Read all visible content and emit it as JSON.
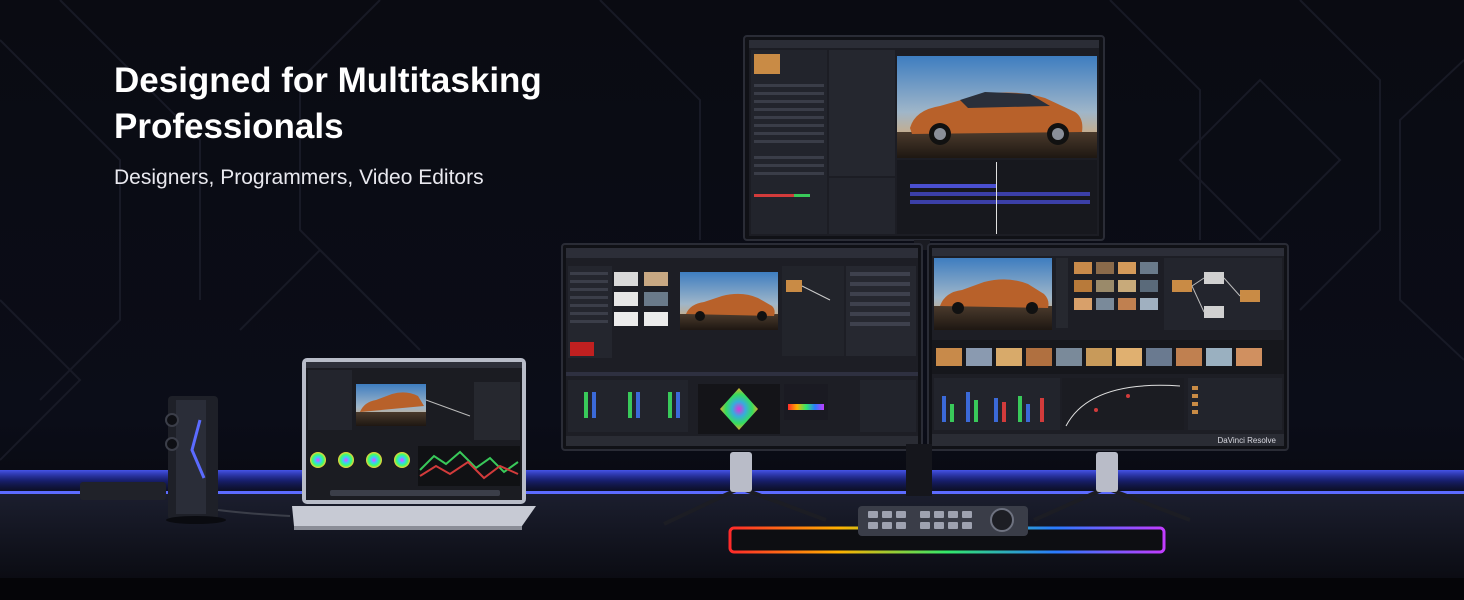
{
  "hero": {
    "title_line1": "Designed for Multitasking",
    "title_line2": "Professionals",
    "subtitle": "Designers, Programmers, Video Editors"
  },
  "scene": {
    "right_monitor_brand": "DaVinci Resolve"
  },
  "colors": {
    "background": "#07080c",
    "desk_glow": "#3b4cff",
    "rgb_pad_colors": [
      "#ff2a2a",
      "#ffb000",
      "#32e86a",
      "#2a7bff",
      "#c23cff"
    ],
    "car_body": "#b8612a",
    "sky_warm": "#f0a34a"
  }
}
